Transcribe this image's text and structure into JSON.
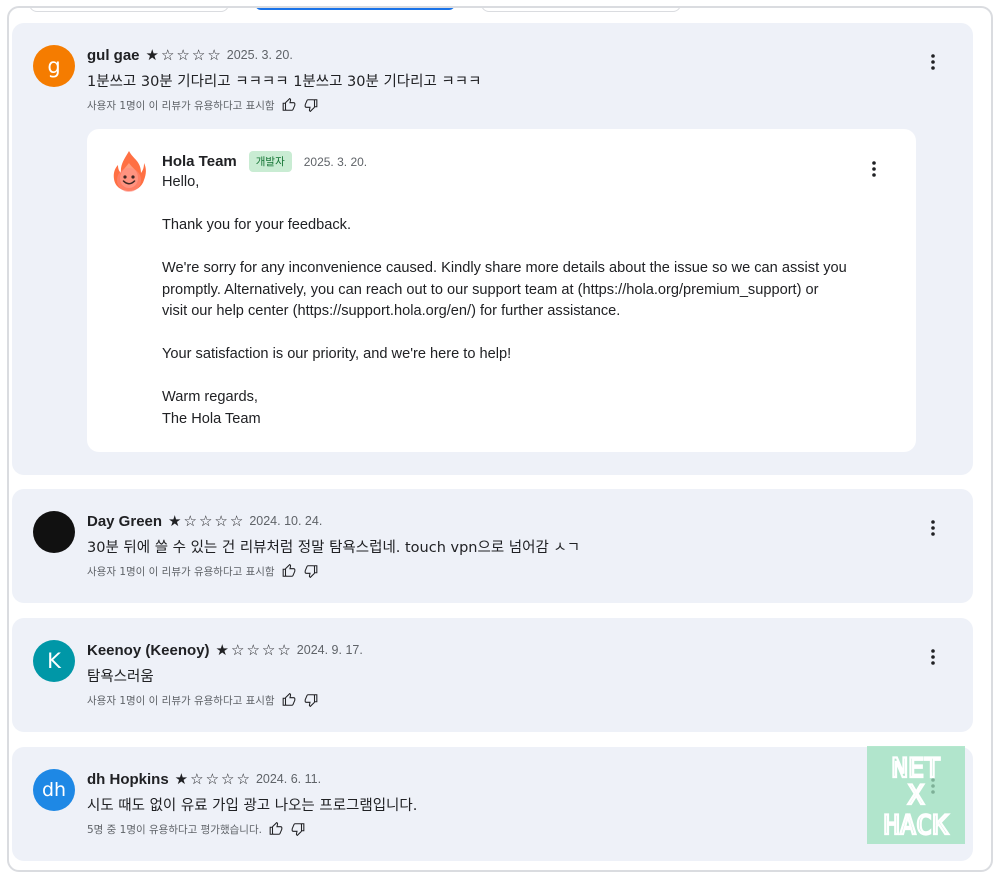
{
  "reviews": [
    {
      "author": "gul gae",
      "avatar_letter": "g",
      "avatar_color": "#f57c00",
      "rating": 1,
      "date": "2025. 3. 20.",
      "text": "1분쓰고 30분 기다리고 ㅋㅋㅋㅋ 1분쓰고 30분 기다리고 ㅋㅋㅋ",
      "helpful": "사용자 1명이 이 리뷰가 유용하다고 표시함",
      "reply": {
        "author": "Hola Team",
        "badge": "개발자",
        "date": "2025. 3. 20.",
        "lines": [
          "Hello,",
          "",
          "Thank you for your feedback.",
          "",
          "We're sorry for any inconvenience caused. Kindly share more details about the issue so we can assist you",
          "promptly. Alternatively, you can reach out to our support team at (https://hola.org/premium_support) or",
          "visit our help center (https://support.hola.org/en/) for further assistance.",
          "",
          "Your satisfaction is our priority, and we're here to help!",
          "",
          "Warm regards,",
          "The Hola Team"
        ]
      }
    },
    {
      "author": "Day Green",
      "avatar_letter": "",
      "avatar_color": "#111111",
      "rating": 1,
      "date": "2024. 10. 24.",
      "text": "30분 뒤에 쓸 수 있는 건 리뷰처럼 정말 탐욕스럽네. touch vpn으로 넘어감 ㅅㄱ",
      "helpful": "사용자 1명이 이 리뷰가 유용하다고 표시함"
    },
    {
      "author": "Keenoy (Keenoy)",
      "avatar_letter": "K",
      "avatar_color": "#0097a7",
      "rating": 1,
      "date": "2024. 9. 17.",
      "text": "탐욕스러움",
      "helpful": "사용자 1명이 이 리뷰가 유용하다고 표시함"
    },
    {
      "author": "dh Hopkins",
      "avatar_letter": "dh",
      "avatar_color": "#1e88e5",
      "rating": 1,
      "date": "2024. 6. 11.",
      "text": "시도 때도 없이 유료 가입 광고 나오는 프로그램입니다.",
      "helpful": "5명 중 1명이 유용하다고 평가했습니다."
    }
  ],
  "icons": {
    "star_filled": "★",
    "star_empty": "☆",
    "more": "more-vert-icon",
    "thumb_up": "thumb-up-icon",
    "thumb_down": "thumb-down-icon"
  },
  "watermark": [
    "NET",
    "X",
    "HACK"
  ]
}
